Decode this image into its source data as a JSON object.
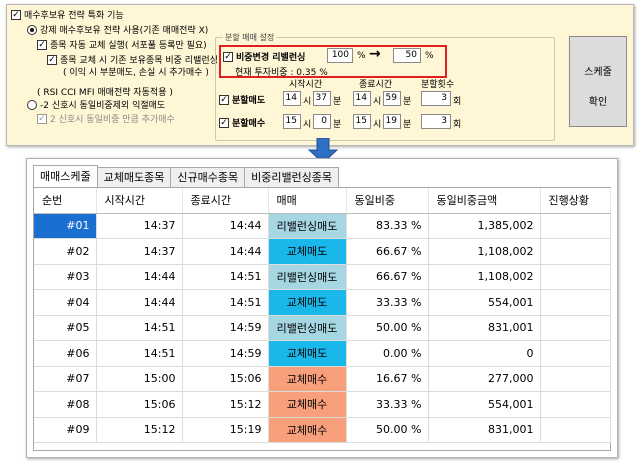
{
  "top": {
    "header_label": "매수후보유 전략 특화 기능",
    "opt_force": "강제 매수후보유 전략 사용(기존 매매전략 X)",
    "opt_auto_swap": "종목 자동 교체 실행( 서포풀 등록만 필요)",
    "opt_rebal_line1": "종목 교체 시 기존 보유종목 비중 리밸런싱",
    "opt_rebal_line2": "( 이익 시 부분매도, 손실 시 추가매수 )",
    "rsi_label": "( RSI CCI MFI 매매전략 자동적용 )",
    "opt_signal_sell": "-2 신호시 동일비중제외 익절매도",
    "opt_signal_buy": "2 신호시 동일비중 만큼 추가매수",
    "split_group_title": "분할 매매 설정",
    "weight_change_label": "비중변경 리밸런싱",
    "weight_from": "100",
    "weight_to": "50",
    "pct_unit": "%",
    "arrow_glyph": "→",
    "current_ratio": "현재 투자비중 : 0.35 %",
    "col_start": "시작시간",
    "col_end": "종료시간",
    "col_count": "분할횟수",
    "split_sell_label": "분할매도",
    "split_buy_label": "분할매수",
    "hour_unit": "시",
    "min_unit": "분",
    "count_unit": "회",
    "sell_start_h": "14",
    "sell_start_m": "37",
    "sell_end_h": "14",
    "sell_end_m": "59",
    "sell_count": "3",
    "buy_start_h": "15",
    "buy_start_m": "0",
    "buy_end_h": "15",
    "buy_end_m": "19",
    "buy_count": "3",
    "schedule_btn_line1": "스케줄",
    "schedule_btn_line2": "확인"
  },
  "tabs": [
    "매매스케줄",
    "교체매도종목",
    "신규매수종목",
    "비중리밸런싱종목"
  ],
  "table": {
    "headers": [
      "순번",
      "시작시간",
      "종료시간",
      "매매",
      "동일비중",
      "동일비중금액",
      "진행상황"
    ],
    "rows": [
      [
        "#01",
        "14:37",
        "14:44",
        "리밸런싱매도",
        "83.33 %",
        "1,385,002",
        ""
      ],
      [
        "#02",
        "14:37",
        "14:44",
        "교체매도",
        "66.67 %",
        "1,108,002",
        ""
      ],
      [
        "#03",
        "14:44",
        "14:51",
        "리밸런싱매도",
        "66.67 %",
        "1,108,002",
        ""
      ],
      [
        "#04",
        "14:44",
        "14:51",
        "교체매도",
        "33.33 %",
        "554,001",
        ""
      ],
      [
        "#05",
        "14:51",
        "14:59",
        "리밸런싱매도",
        "50.00 %",
        "831,001",
        ""
      ],
      [
        "#06",
        "14:51",
        "14:59",
        "교체매도",
        "0.00 %",
        "0",
        ""
      ],
      [
        "#07",
        "15:00",
        "15:06",
        "교체매수",
        "16.67 %",
        "277,000",
        ""
      ],
      [
        "#08",
        "15:06",
        "15:12",
        "교체매수",
        "33.33 %",
        "554,001",
        ""
      ],
      [
        "#09",
        "15:12",
        "15:19",
        "교체매수",
        "50.00 %",
        "831,001",
        ""
      ]
    ]
  },
  "colors": {
    "panel_bg": "#fff6d6",
    "highlight_border": "#e02020",
    "selected_cell": "#1a6fd1",
    "rebalance_sell": "#a7d6e3",
    "swap_sell": "#1ab8ea",
    "swap_buy": "#f8a07c",
    "arrow": "#2f6fc4"
  }
}
